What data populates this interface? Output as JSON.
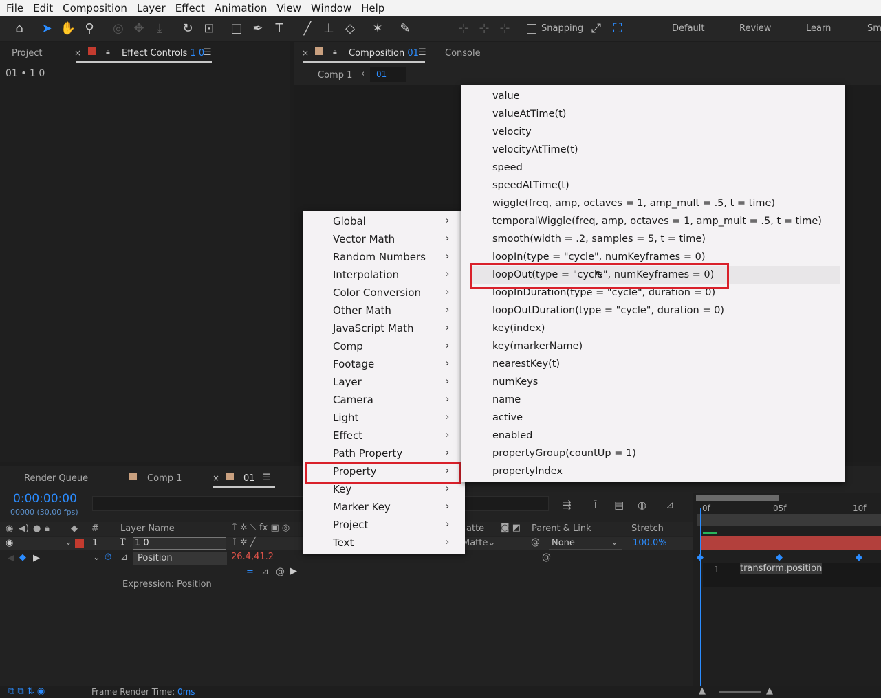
{
  "menubar": [
    "File",
    "Edit",
    "Composition",
    "Layer",
    "Effect",
    "Animation",
    "View",
    "Window",
    "Help"
  ],
  "toolbar": {
    "snapping_label": "Snapping",
    "workspaces": [
      "Default",
      "Review",
      "Learn",
      "Sm"
    ]
  },
  "left_panel": {
    "tab_project": "Project",
    "tab_effect_controls": "Effect Controls",
    "effect_controls_layer": "1 0",
    "breadcrumb": "01 • 1 0"
  },
  "comp_panel": {
    "tab_composition": "Composition",
    "tab_composition_name": "01",
    "tab_console": "Console",
    "crumb_comp1": "Comp 1",
    "crumb_current": "01"
  },
  "menu_categories": [
    {
      "label": "Global"
    },
    {
      "label": "Vector Math"
    },
    {
      "label": "Random Numbers"
    },
    {
      "label": "Interpolation"
    },
    {
      "label": "Color Conversion"
    },
    {
      "label": "Other Math"
    },
    {
      "label": "JavaScript Math"
    },
    {
      "label": "Comp"
    },
    {
      "label": "Footage"
    },
    {
      "label": "Layer"
    },
    {
      "label": "Camera"
    },
    {
      "label": "Light"
    },
    {
      "label": "Effect"
    },
    {
      "label": "Path Property"
    },
    {
      "label": "Property"
    },
    {
      "label": "Key"
    },
    {
      "label": "Marker Key"
    },
    {
      "label": "Project"
    },
    {
      "label": "Text"
    }
  ],
  "menu_property_items": [
    "value",
    "valueAtTime(t)",
    "velocity",
    "velocityAtTime(t)",
    "speed",
    "speedAtTime(t)",
    "wiggle(freq, amp, octaves = 1, amp_mult = .5, t = time)",
    "temporalWiggle(freq, amp, octaves = 1, amp_mult = .5, t = time)",
    "smooth(width = .2, samples = 5, t = time)",
    "loopIn(type = \"cycle\", numKeyframes = 0)",
    "loopOut(type = \"cycle\", numKeyframes = 0)",
    "loopInDuration(type = \"cycle\", duration = 0)",
    "loopOutDuration(type = \"cycle\", duration = 0)",
    "key(index)",
    "key(markerName)",
    "nearestKey(t)",
    "numKeys",
    "name",
    "active",
    "enabled",
    "propertyGroup(countUp = 1)",
    "propertyIndex"
  ],
  "timeline": {
    "tab_render_queue": "Render Queue",
    "tab_comp1": "Comp 1",
    "tab_current": "01",
    "timecode": "0:00:00:00",
    "frames": "00000 (30.00 fps)",
    "col_hash": "#",
    "col_layer_name": "Layer Name",
    "col_matte": "atte",
    "col_parent": "Parent & Link",
    "col_stretch": "Stretch",
    "layer_index": "1",
    "layer_name": "1 0",
    "matte_value": "Matte",
    "parent_value": "None",
    "stretch_value": "100.0%",
    "property_name": "Position",
    "property_value": "26.4,41.2",
    "expression_label": "Expression: Position",
    "ruler_marks": [
      "0f",
      "05f",
      "10f"
    ],
    "expression_line_no": "1",
    "expression_text": "transform.position",
    "frame_render_label": "Frame Render Time:",
    "frame_render_value": "0ms"
  },
  "colors": {
    "accent_blue": "#2b8cff",
    "highlight_red": "#d9202a",
    "layer_red": "#c33b2f",
    "property_value_red": "#e0534a"
  }
}
